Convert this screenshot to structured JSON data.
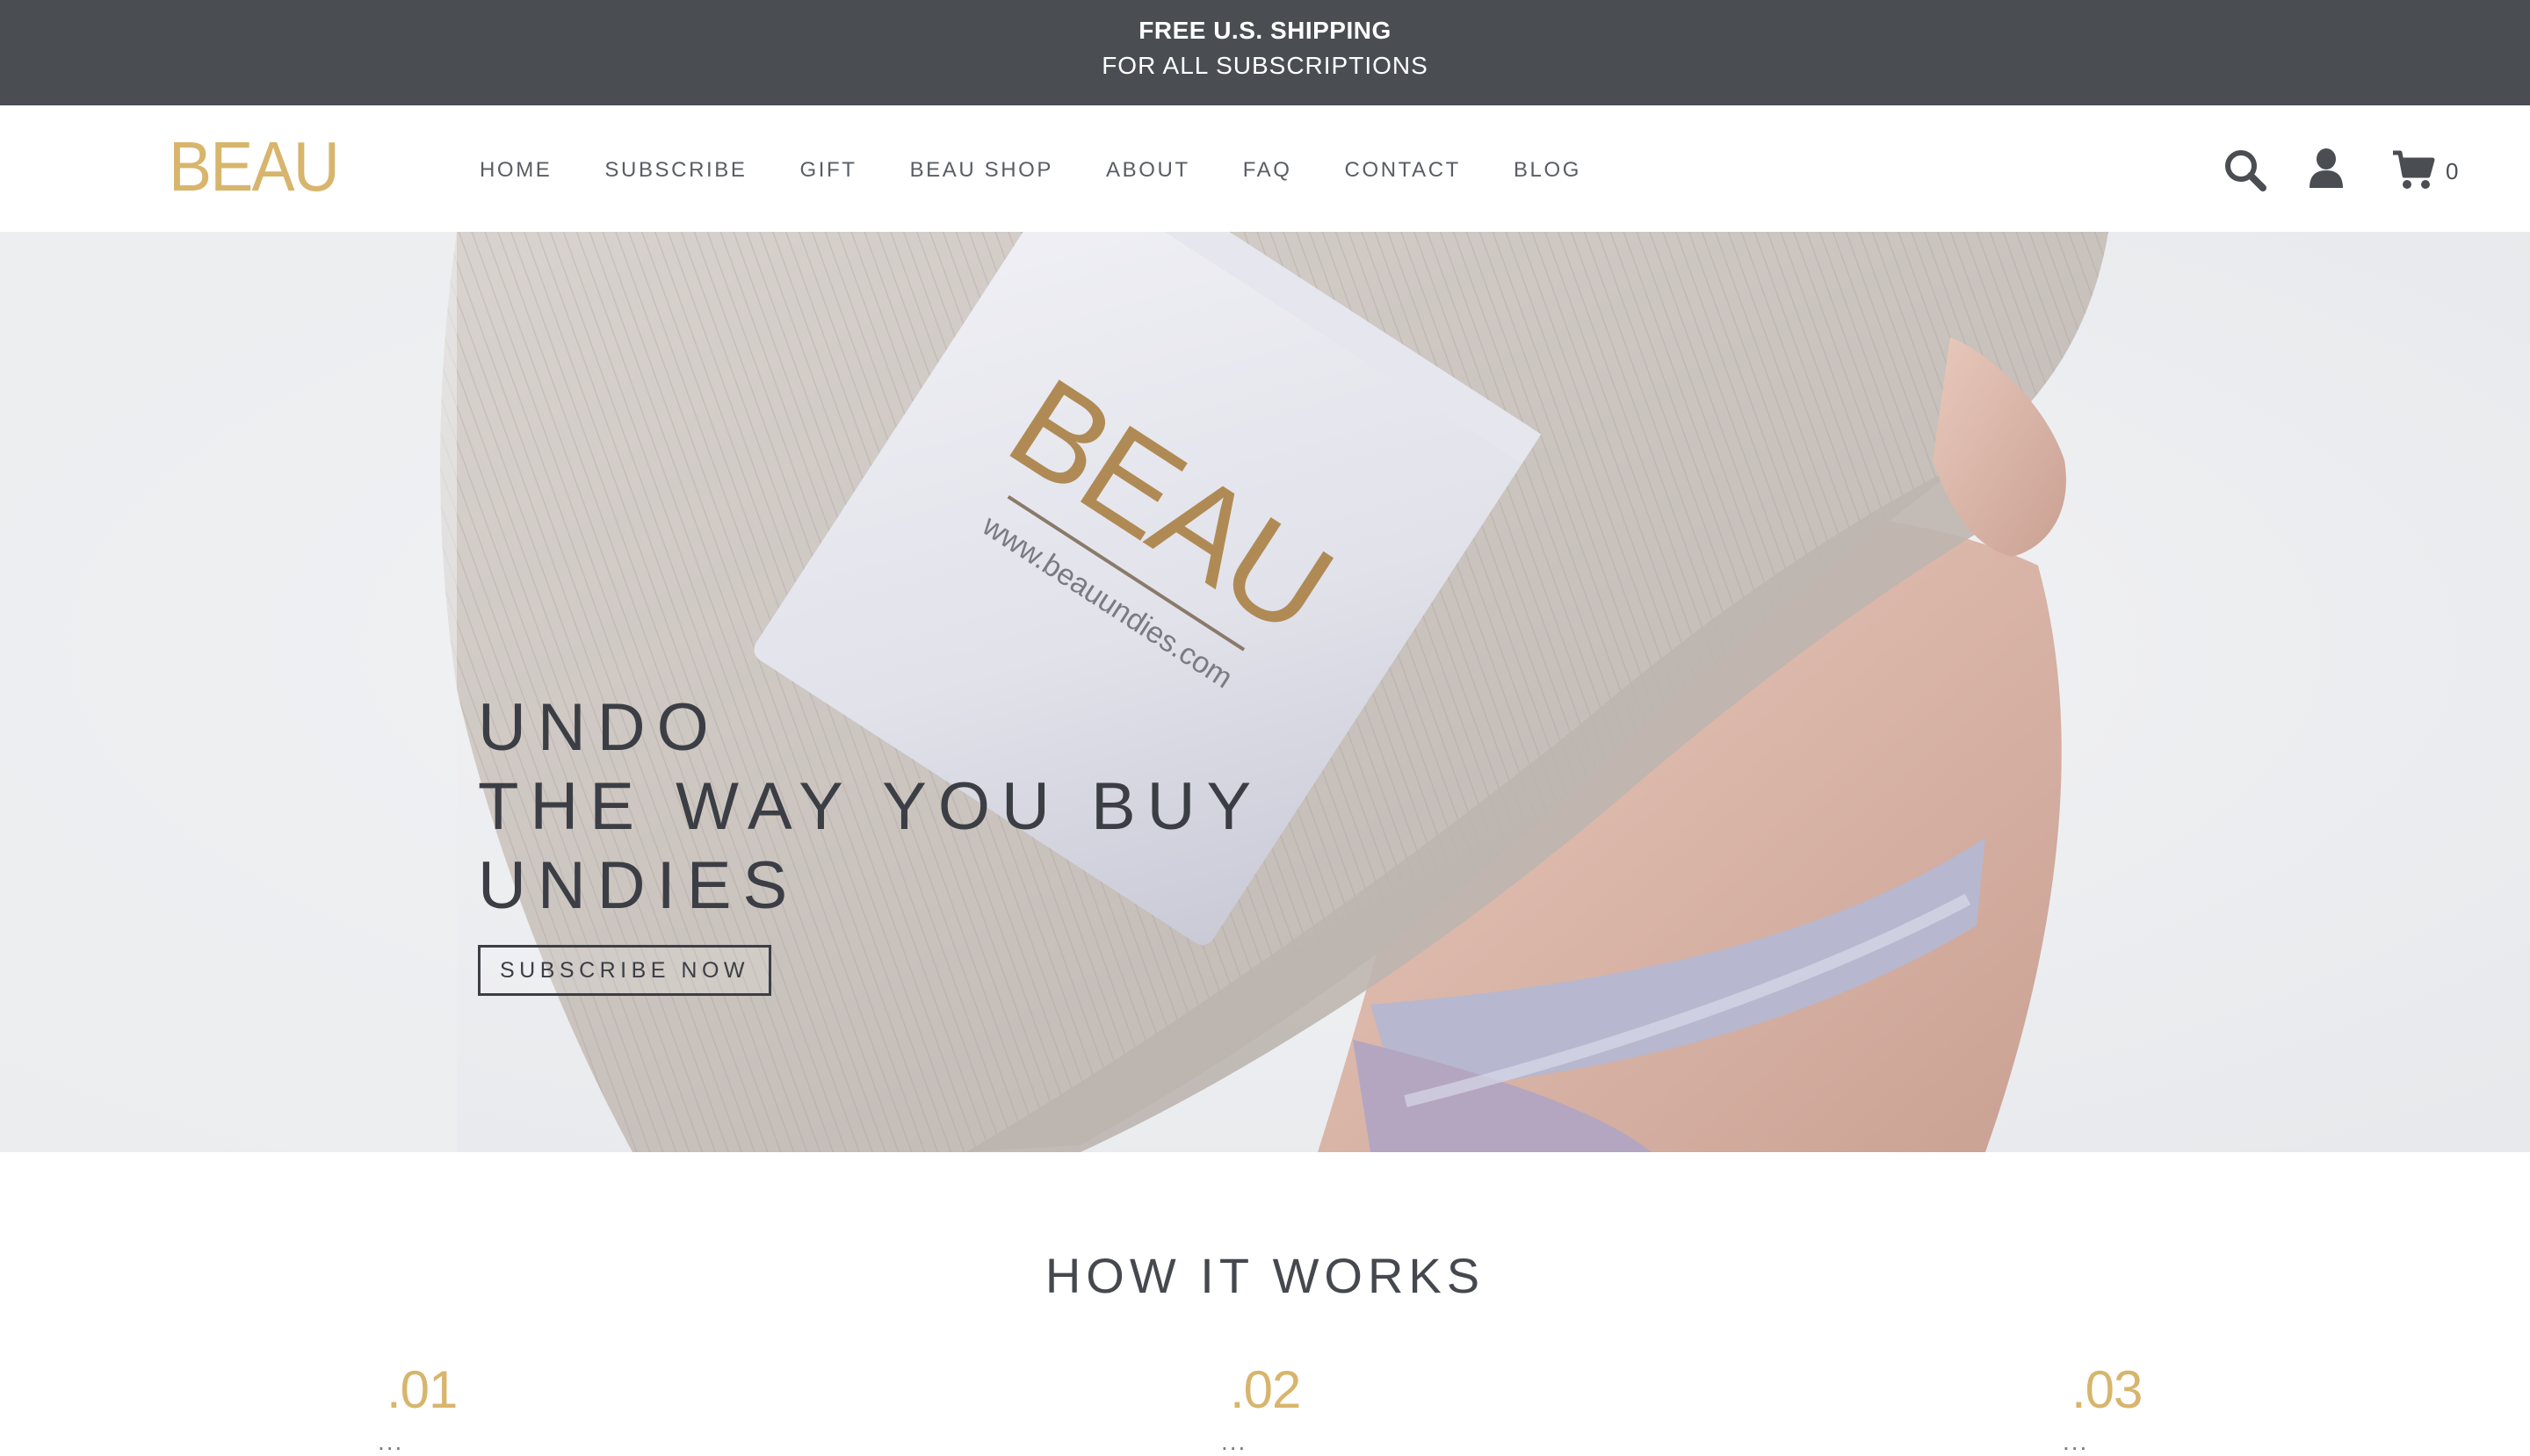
{
  "announcement": {
    "line1": "FREE U.S. SHIPPING",
    "line2": "FOR ALL SUBSCRIPTIONS"
  },
  "header": {
    "logo": "BEAU",
    "nav": [
      "HOME",
      "SUBSCRIBE",
      "GIFT",
      "BEAU SHOP",
      "ABOUT",
      "FAQ",
      "CONTACT",
      "BLOG"
    ],
    "icons": [
      "search-icon",
      "user-icon",
      "cart-icon"
    ],
    "cart_count": "0"
  },
  "hero": {
    "title_lines": [
      "UNDO",
      "THE WAY YOU BUY",
      "UNDIES"
    ],
    "cta_label": "SUBSCRIBE NOW",
    "package_logo": "BEAU",
    "package_url": "www.beauundies.com"
  },
  "how_it_works": {
    "title": "HOW IT WORKS",
    "steps": [
      {
        "number": ".01",
        "text": "..."
      },
      {
        "number": ".02",
        "text": "..."
      },
      {
        "number": ".03",
        "text": "..."
      }
    ]
  },
  "colors": {
    "announcement_bg": "#4a4d52",
    "brand_gold": "#d8b56c",
    "text_dark": "#3b3e44"
  }
}
